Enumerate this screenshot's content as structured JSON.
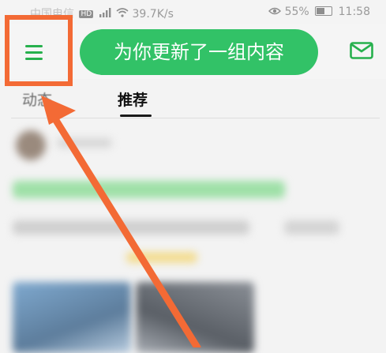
{
  "status_bar": {
    "carrier": "中国电信",
    "hd_badge": "HD",
    "network_speed": "39.7K/s",
    "battery_percent": "55%",
    "time": "11:58"
  },
  "app_bar": {
    "toast_text": "为你更新了一组内容"
  },
  "tabs": [
    {
      "label": "动态",
      "selected": false
    },
    {
      "label": "推荐",
      "selected": true
    }
  ],
  "colors": {
    "accent_green": "#32c267",
    "annotation_orange": "#f36a35"
  }
}
